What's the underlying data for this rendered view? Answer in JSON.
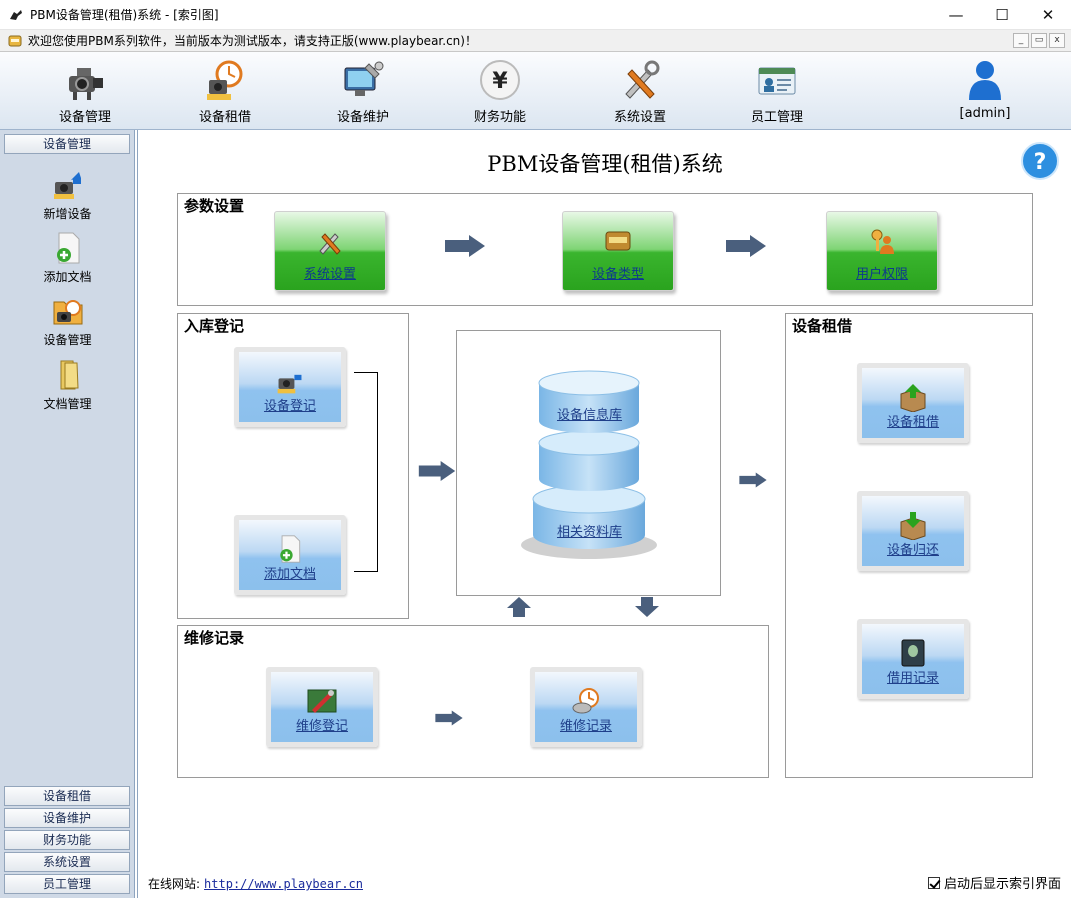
{
  "window": {
    "title": "PBM设备管理(租借)系统 - [索引图]",
    "controls": {
      "minimize": "—",
      "maximize": "☐",
      "close": "✕"
    }
  },
  "infobar": {
    "text": "欢迎您使用PBM系列软件，当前版本为测试版本，请支持正版(www.playbear.cn)！",
    "mdi": {
      "minimize": "_",
      "restore": "▭",
      "close": "x"
    }
  },
  "toolbar": {
    "items": [
      {
        "label": "设备管理",
        "icon": "camera-icon"
      },
      {
        "label": "设备租借",
        "icon": "lend-icon"
      },
      {
        "label": "设备维护",
        "icon": "repair-icon"
      },
      {
        "label": "财务功能",
        "icon": "yen-icon"
      },
      {
        "label": "系统设置",
        "icon": "tools-icon"
      },
      {
        "label": "员工管理",
        "icon": "staff-card-icon"
      },
      {
        "label": "[admin]",
        "icon": "user-icon"
      }
    ]
  },
  "sidebar": {
    "header": "设备管理",
    "items": [
      {
        "label": "新增设备",
        "icon": "new-device-icon"
      },
      {
        "label": "添加文档",
        "icon": "add-document-icon"
      },
      {
        "label": "设备管理",
        "icon": "device-manage-icon"
      },
      {
        "label": "文档管理",
        "icon": "folder-icon"
      }
    ],
    "bottom": [
      "设备租借",
      "设备维护",
      "财务功能",
      "系统设置",
      "员工管理"
    ]
  },
  "main": {
    "title": "PBM设备管理(租借)系统",
    "params": {
      "title": "参数设置",
      "buttons": [
        "系统设置",
        "设备类型",
        "用户权限"
      ]
    },
    "storage": {
      "title": "入库登记",
      "buttons": [
        "设备登记",
        "添加文档"
      ]
    },
    "database": {
      "top": "设备信息库",
      "bottom": "相关资料库"
    },
    "lending": {
      "title": "设备租借",
      "buttons": [
        "设备租借",
        "设备归还",
        "借用记录"
      ]
    },
    "repair": {
      "title": "维修记录",
      "buttons": [
        "维修登记",
        "维修记录"
      ]
    },
    "footer": {
      "site_label": "在线网站:",
      "site_url": "http://www.playbear.cn",
      "checkbox_label": "启动后显示索引界面",
      "checkbox_checked": true
    }
  },
  "colors": {
    "accent": "#1f3f8a",
    "sidebar_bg": "#cfd9e6",
    "green_button": "#3ab52e",
    "blue_button": "#8fc2ef"
  }
}
